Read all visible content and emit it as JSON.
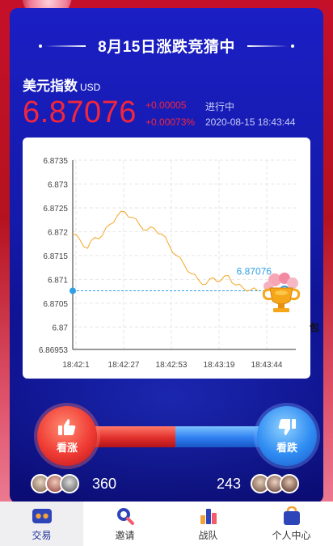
{
  "header": {
    "title": "8月15日涨跌竞猜中"
  },
  "index": {
    "name": "美元指数",
    "unit": "USD",
    "price": "6.87076",
    "change": "+0.00005",
    "change_pct": "+0.00073%",
    "status": "进行中",
    "time": "2020-08-15 18:43:44"
  },
  "chart_data": {
    "type": "line",
    "y_ticks": [
      "6.8735",
      "6.873",
      "6.8725",
      "6.872",
      "6.8715",
      "6.871",
      "6.8705",
      "6.87",
      "6.86953"
    ],
    "x_ticks": [
      "18:42:1",
      "18:42:27",
      "18:42:53",
      "18:43:19",
      "18:43:44"
    ],
    "ylim": [
      6.86953,
      6.8735
    ],
    "series": [
      {
        "color": "#f5a623",
        "x": [
          "18:42:01",
          "18:42:05",
          "18:42:09",
          "18:42:13",
          "18:42:17",
          "18:42:21",
          "18:42:25",
          "18:42:29",
          "18:42:33",
          "18:42:37",
          "18:42:41",
          "18:42:45",
          "18:42:49",
          "18:42:53",
          "18:42:57",
          "18:43:01",
          "18:43:05",
          "18:43:09",
          "18:43:13",
          "18:43:17",
          "18:43:21",
          "18:43:25",
          "18:43:29",
          "18:43:33",
          "18:43:37",
          "18:43:41"
        ],
        "values": [
          6.87195,
          6.87182,
          6.87165,
          6.87188,
          6.87192,
          6.87215,
          6.87233,
          6.87242,
          6.8723,
          6.87215,
          6.87203,
          6.87207,
          6.87195,
          6.87172,
          6.8715,
          6.87132,
          6.87112,
          6.87098,
          6.8709,
          6.87103,
          6.87097,
          6.87108,
          6.87088,
          6.87082,
          6.87078,
          6.87076
        ]
      }
    ],
    "baseline": 6.87076,
    "current_label": "6.87076",
    "baseline_color": "#2fa0e6",
    "grid": true
  },
  "edge_text": "包",
  "actions": {
    "rise_label": "看涨",
    "fall_label": "看跌",
    "rise_count": "360",
    "fall_count": "243"
  },
  "tabs": [
    {
      "label": "交易",
      "icon": "trade-icon",
      "active": true
    },
    {
      "label": "邀请",
      "icon": "invite-icon",
      "active": false
    },
    {
      "label": "战队",
      "icon": "team-icon",
      "active": false
    },
    {
      "label": "个人中心",
      "icon": "profile-icon",
      "active": false
    }
  ],
  "colors": {
    "panel": "#1b1fc4",
    "price": "#f3263c",
    "rise": "#ef3b33",
    "fall": "#2f8cf2",
    "active_tab": "#1c2f9a"
  }
}
